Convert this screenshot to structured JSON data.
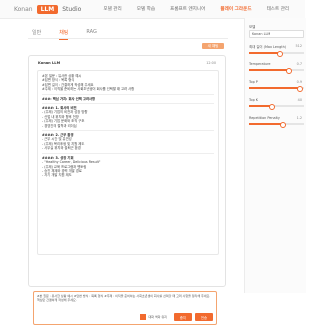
{
  "brand": {
    "konan": "Konan",
    "llm": "LLM",
    "studio": "Studio"
  },
  "nav": [
    "모델 관리",
    "모델 학습",
    "프롬프트 엔지니어",
    "플레이 그라운드",
    "테스트 관리"
  ],
  "tabs": [
    "일반",
    "채팅",
    "RAG"
  ],
  "new_chat_label": "새 채팅",
  "chat": {
    "header_name": "Konan LLM",
    "header_meta": "12:00",
    "lines": [
      {
        "t": "#본 질문 : 유사한 상황 예시",
        "h": false
      },
      {
        "t": "#답변 방식 : 목록 형식",
        "h": false
      },
      {
        "t": "#답변 길이 : 간결하게 작성해 주세요",
        "h": false
      },
      {
        "t": "#주제 : 이직을 준비하는 사회초년생이 회사를 선택할 때 고려 사항",
        "h": false
      },
      {
        "t": "",
        "h": false,
        "sep": true
      },
      {
        "t": "###: 핵심 가치: 회사 선택 고려사항",
        "h": true
      },
      {
        "t": "",
        "h": false,
        "sep": true
      },
      {
        "t": "####: 1. 회사의 비전",
        "h": true
      },
      {
        "t": "- (주제) 기업의 비전과 성장 방향",
        "h": false
      },
      {
        "t": "- 산업 내 위치와 향후 전망",
        "h": false
      },
      {
        "t": "- (주제) 기업 문화와 조직 구조",
        "h": false
      },
      {
        "t": "- 경영진의 철학과 리더십",
        "h": false
      },
      {
        "t": "",
        "h": false,
        "sep": true
      },
      {
        "t": "####: 2. 근무 환경",
        "h": true
      },
      {
        "t": "- 근무 시간 및 유연성",
        "h": false
      },
      {
        "t": "- (주제) 복리후생 및 지원 제도",
        "h": false
      },
      {
        "t": "- 사무실 위치와 출퇴근 환경",
        "h": false
      },
      {
        "t": "",
        "h": false,
        "sep": true
      },
      {
        "t": "####: 3. 성장 기회",
        "h": true
      },
      {
        "t": "- \"Healthy Career, Delicious Result\"",
        "h": false
      },
      {
        "t": "- (주제) 교육 프로그램과 멘토링",
        "h": false
      },
      {
        "t": "- 승진 체계와 경력 개발 경로",
        "h": false
      },
      {
        "t": "- 자기 개발 지원 제도",
        "h": false
      }
    ]
  },
  "input": {
    "text": "#본 질문 : 유사한 상황 예시 #답변 방식 : 목록 형식 #주제 : 이직을 준비하는 사회초년생이 회사를 선택할 때 고려 사항을 정리해 주세요. 핵심만 간결하게 작성해 주세요.",
    "checkbox_label": "대화 맥락 유지",
    "stop_label": "중지",
    "send_label": "전송"
  },
  "panel": {
    "model_label": "모델",
    "model_value": "Konan LLM",
    "controls": [
      {
        "label": "최대 길이 (Max Length)",
        "value": "512",
        "fill": 0.55
      },
      {
        "label": "Temperature",
        "value": "0.7",
        "fill": 0.7
      },
      {
        "label": "Top P",
        "value": "0.9",
        "fill": 0.9
      },
      {
        "label": "Top K",
        "value": "40",
        "fill": 0.4
      },
      {
        "label": "Repetition Penalty",
        "value": "1.2",
        "fill": 0.6
      }
    ]
  },
  "colors": {
    "accent": "#f26a2e",
    "accent_light": "#f4a46f"
  }
}
